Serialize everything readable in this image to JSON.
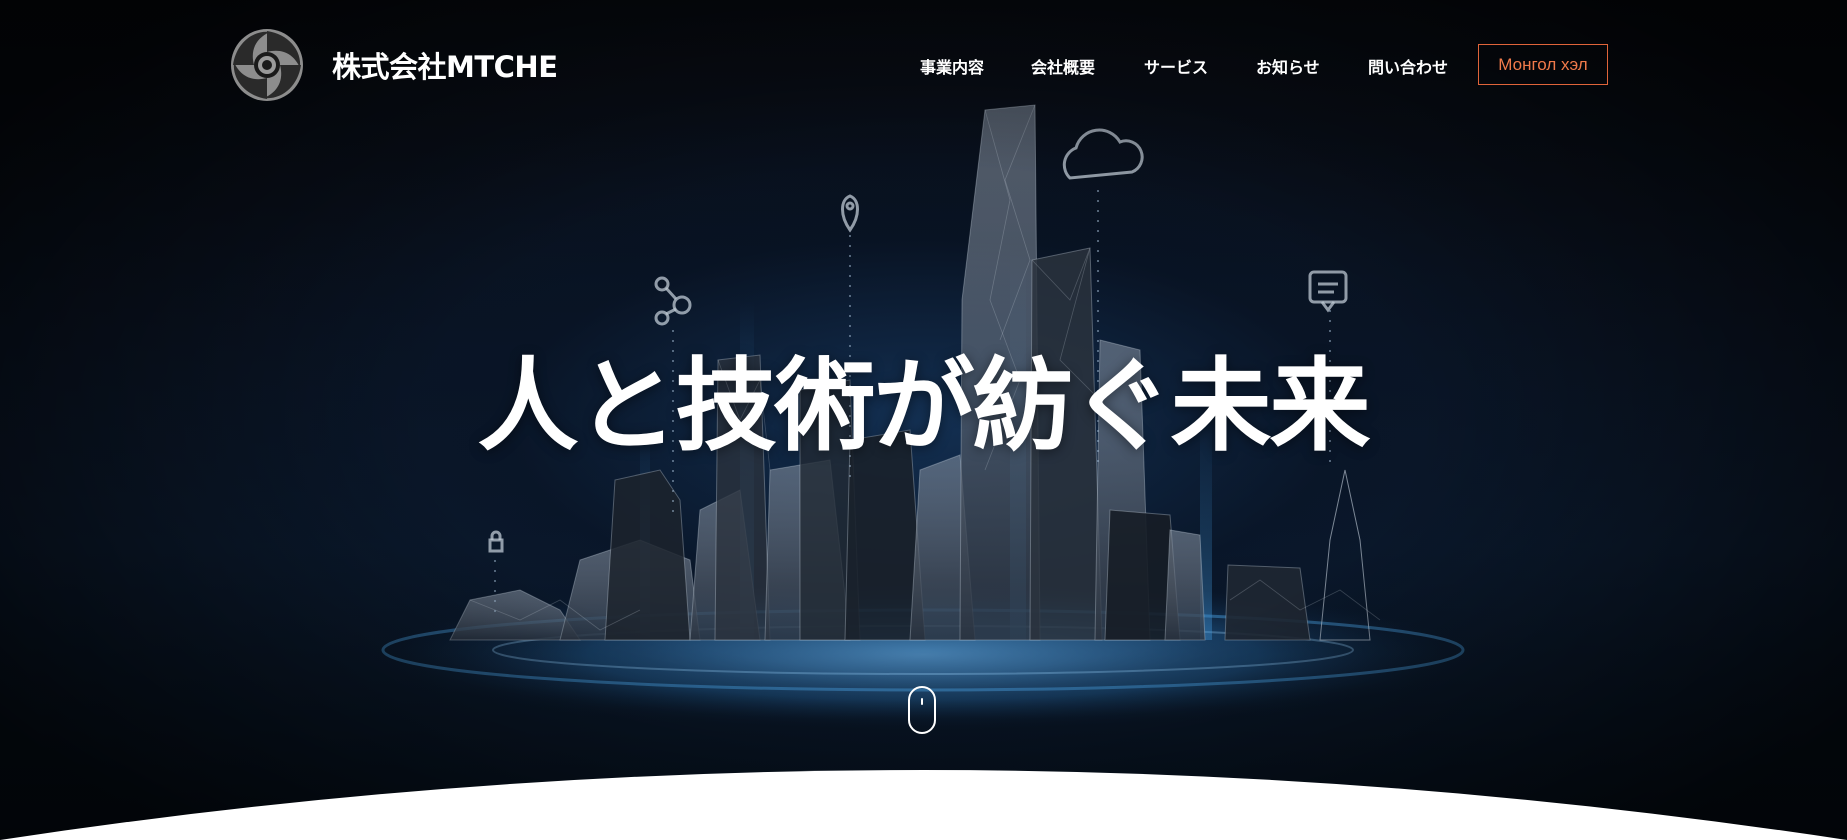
{
  "site": {
    "company_name": "株式会社MTCHE"
  },
  "nav": {
    "items": [
      {
        "label": "事業内容"
      },
      {
        "label": "会社概要"
      },
      {
        "label": "サービス"
      },
      {
        "label": "お知らせ"
      },
      {
        "label": "問い合わせ"
      }
    ],
    "language_button": "Монгол хэл"
  },
  "hero": {
    "headline": "人と技術が紡ぐ未来",
    "scroll_indicator_icon": "mouse-scroll-icon"
  },
  "colors": {
    "accent": "#e0643a",
    "text": "#ffffff",
    "background": "#05070b"
  }
}
